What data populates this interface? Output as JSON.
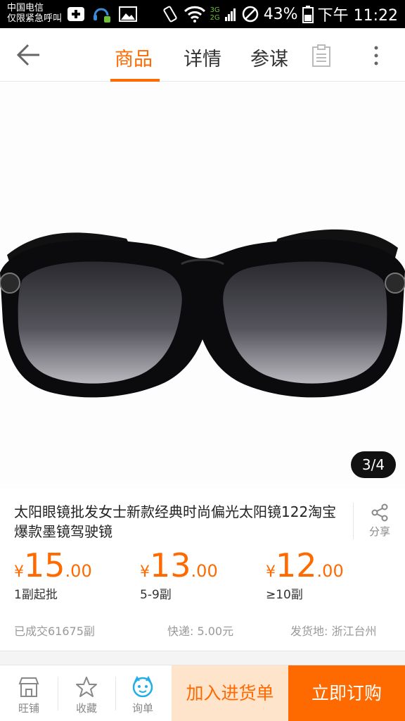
{
  "status_bar": {
    "carrier_line1": "中国电信",
    "carrier_line2": "仅限紧急呼叫",
    "network_top": "3G",
    "network_bottom": "2G",
    "battery": "43%",
    "time": "下午 11:22"
  },
  "header": {
    "tabs": [
      {
        "label": "商品",
        "active": true
      },
      {
        "label": "详情",
        "active": false
      },
      {
        "label": "参谋",
        "active": false
      }
    ],
    "accent_color": "#ff6a00"
  },
  "product": {
    "image_counter": "3/4",
    "title": "太阳眼镜批发女士新款经典时尚偏光太阳镜122淘宝爆款墨镜驾驶镜",
    "share_label": "分享",
    "price_tiers": [
      {
        "currency": "¥",
        "integer": "15",
        "decimal": ".00",
        "quantity": "1副起批"
      },
      {
        "currency": "¥",
        "integer": "13",
        "decimal": ".00",
        "quantity": "5-9副"
      },
      {
        "currency": "¥",
        "integer": "12",
        "decimal": ".00",
        "quantity": "≥10副"
      }
    ],
    "sold": "已成交61675副",
    "shipping": "快递: 5.00元",
    "origin": "发货地: 浙江台州"
  },
  "bottom_bar": {
    "store_label": "旺铺",
    "favorite_label": "收藏",
    "inquiry_label": "询单",
    "add_to_cart": "加入进货单",
    "buy_now": "立即订购"
  }
}
